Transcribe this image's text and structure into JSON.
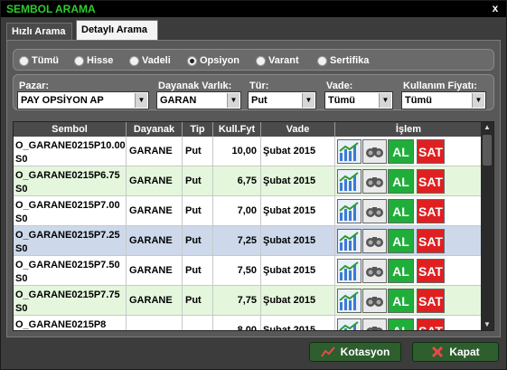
{
  "window": {
    "title": "SEMBOL ARAMA",
    "close": "x"
  },
  "tabs": [
    {
      "label": "Hızlı Arama"
    },
    {
      "label": "Detaylı Arama"
    }
  ],
  "radios": [
    {
      "label": "Tümü",
      "checked": false
    },
    {
      "label": "Hisse",
      "checked": false
    },
    {
      "label": "Vadeli",
      "checked": false
    },
    {
      "label": "Opsiyon",
      "checked": true
    },
    {
      "label": "Varant",
      "checked": false
    },
    {
      "label": "Sertifika",
      "checked": false
    }
  ],
  "filters": {
    "market": {
      "label": "Pazar:",
      "value": "PAY OPSİYON AP"
    },
    "underlying": {
      "label": "Dayanak Varlık:",
      "value": "GARAN"
    },
    "type": {
      "label": "Tür:",
      "value": "Put"
    },
    "expiry": {
      "label": "Vade:",
      "value": "Tümü"
    },
    "strike": {
      "label": "Kullanım Fiyatı:",
      "value": "Tümü"
    }
  },
  "grid": {
    "columns": [
      "Sembol",
      "Dayanak",
      "Tip",
      "Kull.Fyt",
      "Vade",
      "İşlem"
    ],
    "actions": {
      "buy": "AL",
      "sell": "SAT"
    },
    "rows": [
      {
        "symbol": "O_GARANE0215P10.00S0",
        "underlying": "GARANE",
        "type": "Put",
        "strike": "10,00",
        "expiry": "Şubat 2015"
      },
      {
        "symbol": "O_GARANE0215P6.75S0",
        "underlying": "GARANE",
        "type": "Put",
        "strike": "6,75",
        "expiry": "Şubat 2015"
      },
      {
        "symbol": "O_GARANE0215P7.00S0",
        "underlying": "GARANE",
        "type": "Put",
        "strike": "7,00",
        "expiry": "Şubat 2015"
      },
      {
        "symbol": "O_GARANE0215P7.25S0",
        "underlying": "GARANE",
        "type": "Put",
        "strike": "7,25",
        "expiry": "Şubat 2015"
      },
      {
        "symbol": "O_GARANE0215P7.50S0",
        "underlying": "GARANE",
        "type": "Put",
        "strike": "7,50",
        "expiry": "Şubat 2015"
      },
      {
        "symbol": "O_GARANE0215P7.75S0",
        "underlying": "GARANE",
        "type": "Put",
        "strike": "7,75",
        "expiry": "Şubat 2015"
      },
      {
        "symbol": "O_GARANE0215P8",
        "underlying": "",
        "type": "",
        "strike": "8,00",
        "expiry": "Şubat 2015"
      }
    ]
  },
  "footer": {
    "quote_label": "Kotasyon",
    "close_label": "Kapat"
  }
}
